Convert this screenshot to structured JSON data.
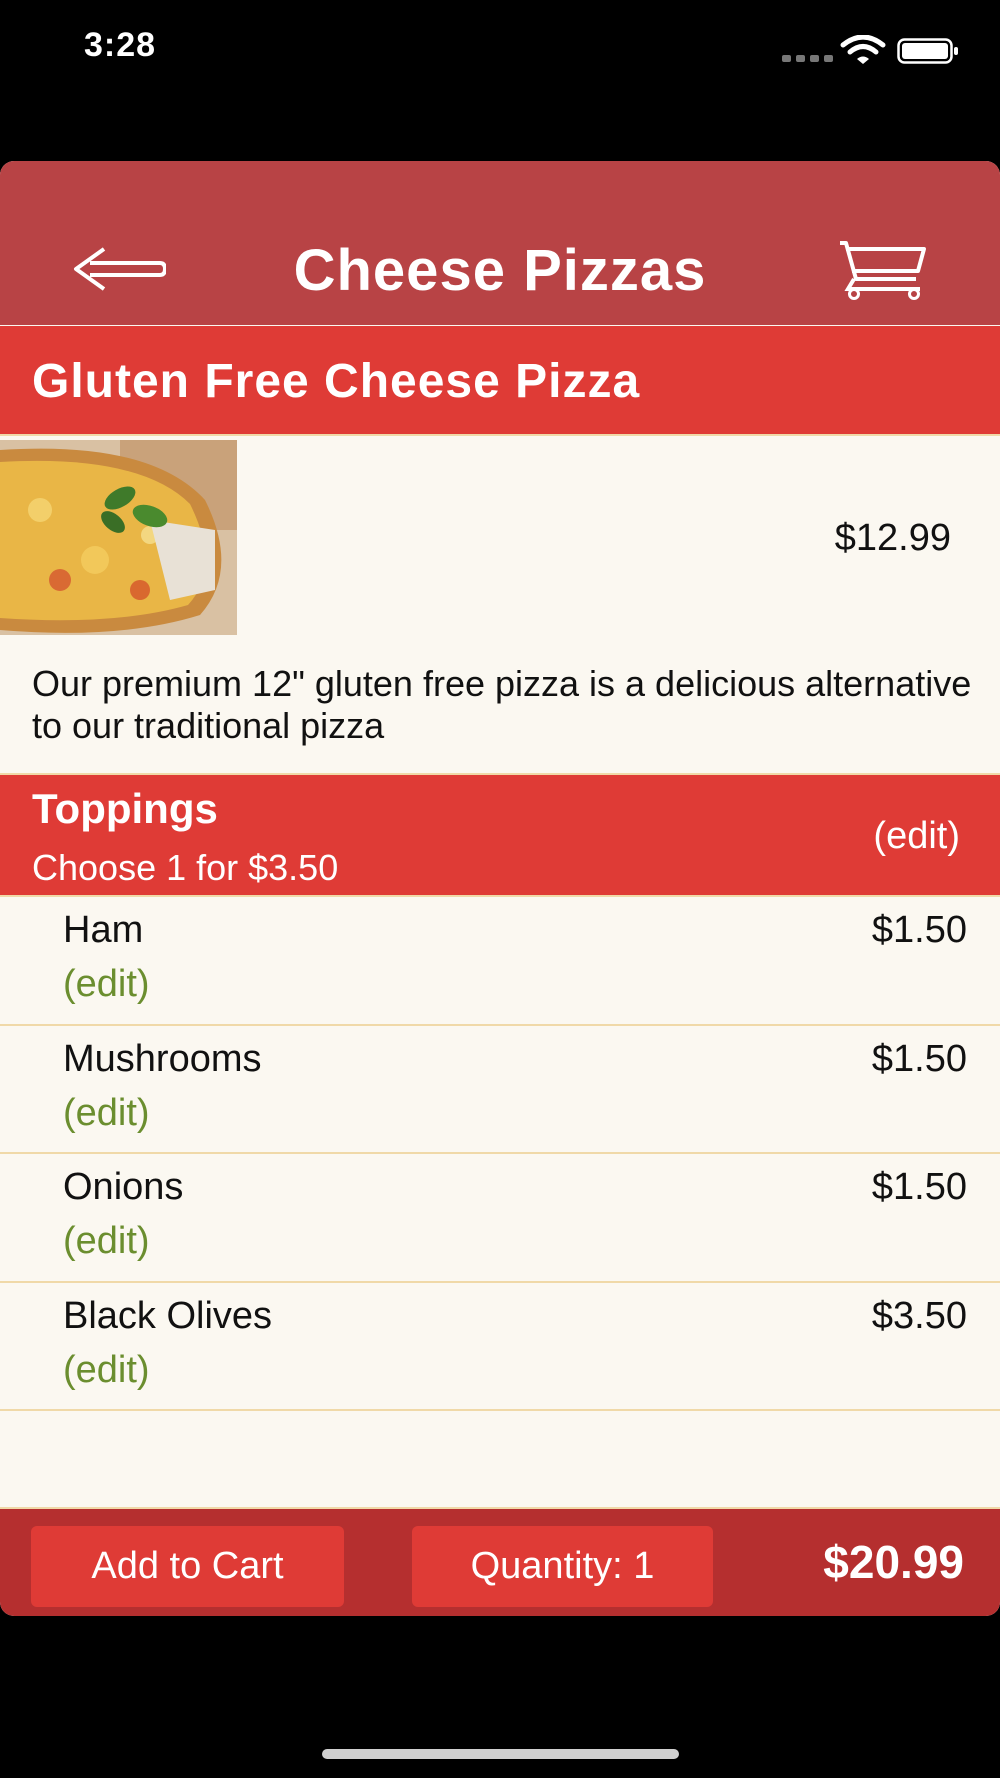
{
  "status_bar": {
    "time": "3:28"
  },
  "nav": {
    "title": "Cheese Pizzas",
    "back_icon": "arrow-left-icon",
    "cart_icon": "cart-icon"
  },
  "item": {
    "name": "Gluten Free Cheese Pizza",
    "price": "$12.99",
    "description": "Our premium 12\" gluten free pizza is a delicious alternative to our traditional pizza"
  },
  "toppings": {
    "title": "Toppings",
    "subtitle": "Choose 1 for $3.50",
    "edit_label": "(edit)",
    "items": [
      {
        "name": "Ham",
        "price": "$1.50",
        "edit": "(edit)"
      },
      {
        "name": "Mushrooms",
        "price": "$1.50",
        "edit": "(edit)"
      },
      {
        "name": "Onions",
        "price": "$1.50",
        "edit": "(edit)"
      },
      {
        "name": "Black Olives",
        "price": "$3.50",
        "edit": "(edit)"
      }
    ]
  },
  "footer": {
    "add_to_cart": "Add to Cart",
    "quantity": "Quantity: 1",
    "total": "$20.99"
  },
  "colors": {
    "nav": "#b84345",
    "accent_red": "#df3b36",
    "footer": "#b52f2f",
    "background": "#fbf8f1",
    "edit_green": "#6b8e2f"
  }
}
